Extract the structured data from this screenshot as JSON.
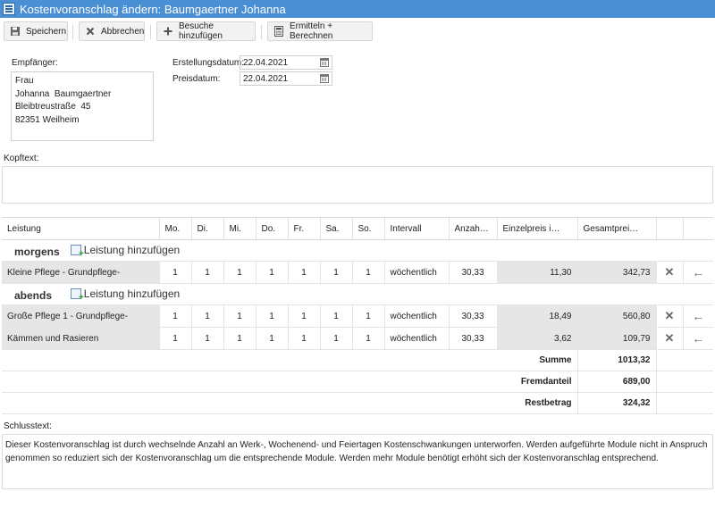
{
  "window": {
    "title": "Kostenvoranschlag ändern: Baumgaertner Johanna"
  },
  "toolbar": {
    "save_label": "Speichern",
    "cancel_label": "Abbrechen",
    "add_visits_label": "Besuche hinzufügen",
    "calculate_label": "Ermitteln + Berechnen"
  },
  "recipient": {
    "label": "Empfänger:",
    "text": "Frau\nJohanna  Baumgaertner\nBleibtreustraße  45\n82351 Weilheim"
  },
  "dates": {
    "created_label": "Erstellungsdatum:",
    "created_value": "22.04.2021",
    "price_label": "Preisdatum:",
    "price_value": "22.04.2021"
  },
  "header_text": {
    "label": "Kopftext:",
    "value": ""
  },
  "table": {
    "columns": [
      "Leistung",
      "Mo.",
      "Di.",
      "Mi.",
      "Do.",
      "Fr.",
      "Sa.",
      "So.",
      "Intervall",
      "Anzah…",
      "Einzelpreis i…",
      "Gesamtprei…",
      "",
      ""
    ],
    "add_service_label": "Leistung hinzufügen",
    "groups": [
      {
        "name": "morgens",
        "rows": [
          {
            "service": "Kleine Pflege - Grundpflege-",
            "mo": "1",
            "di": "1",
            "mi": "1",
            "do": "1",
            "fr": "1",
            "sa": "1",
            "so": "1",
            "interval": "wöchentlich",
            "count": "30,33",
            "unit_price": "11,30",
            "total": "342,73"
          }
        ]
      },
      {
        "name": "abends",
        "rows": [
          {
            "service": "Große Pflege 1 - Grundpflege-",
            "mo": "1",
            "di": "1",
            "mi": "1",
            "do": "1",
            "fr": "1",
            "sa": "1",
            "so": "1",
            "interval": "wöchentlich",
            "count": "30,33",
            "unit_price": "18,49",
            "total": "560,80"
          },
          {
            "service": "Kämmen und Rasieren",
            "mo": "1",
            "di": "1",
            "mi": "1",
            "do": "1",
            "fr": "1",
            "sa": "1",
            "so": "1",
            "interval": "wöchentlich",
            "count": "30,33",
            "unit_price": "3,62",
            "total": "109,79"
          }
        ]
      }
    ],
    "totals": [
      {
        "label": "Summe",
        "value": "1013,32"
      },
      {
        "label": "Fremdanteil",
        "value": "689,00"
      },
      {
        "label": "Restbetrag",
        "value": "324,32"
      }
    ]
  },
  "closing_text": {
    "label": "Schlusstext:",
    "value": "Dieser Kostenvoranschlag ist durch wechselnde Anzahl an Werk-, Wochenend- und Feiertagen Kostenschwankungen unterworfen. Werden aufgeführte Module nicht in Anspruch genommen so reduziert sich der Kostenvoranschlag um die entsprechende Module. Werden mehr Module benötigt erhöht sich der Kostenvoranschlag entsprechend."
  },
  "icons": {
    "window": "document-icon",
    "save": "floppy-disk-icon",
    "cancel": "close-icon",
    "add_visits": "plus-icon",
    "calculate": "calculator-icon",
    "calendar": "calendar-icon",
    "add_service": "add-document-icon",
    "delete_row": "close-icon",
    "move_row": "arrow-left-icon"
  }
}
